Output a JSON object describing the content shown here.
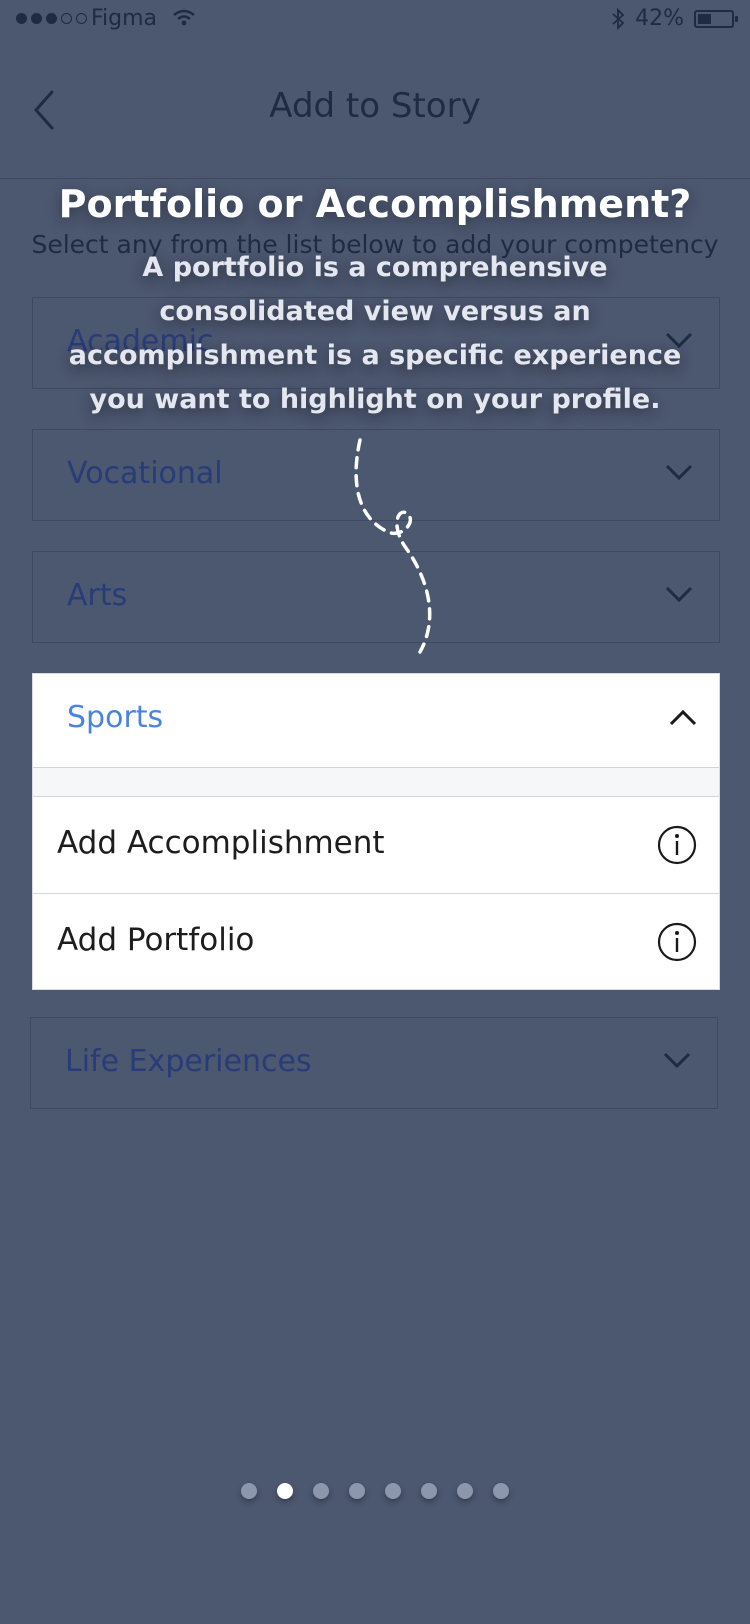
{
  "status_bar": {
    "carrier": "Figma",
    "battery": "42%",
    "battery_level": 0.42,
    "signal_bars": 3,
    "signal_total": 5
  },
  "nav": {
    "title": "Add to Story",
    "back_icon": "chevron-left-icon"
  },
  "subtitle": "Select any from the list below to add your competency",
  "categories": [
    {
      "label": "Academic"
    },
    {
      "label": "Vocational"
    },
    {
      "label": "Arts"
    },
    {
      "label": "Life Experiences"
    }
  ],
  "coach_mark": {
    "title": "Portfolio or Accomplishment?",
    "body": "A portfolio is a comprehensive consolidated view versus an accomplishment is a specific experience you want to highlight on your profile."
  },
  "sports": {
    "label": "Sports",
    "options": [
      {
        "label": "Add Accomplishment",
        "icon": "info-icon"
      },
      {
        "label": "Add Portfolio",
        "icon": "info-icon"
      }
    ]
  },
  "pager": {
    "count": 8,
    "active_index": 1
  },
  "colors": {
    "overlay_bg": "#4c5770",
    "sports_accent": "#4a84e0",
    "dimmed_label": "#273c78"
  }
}
